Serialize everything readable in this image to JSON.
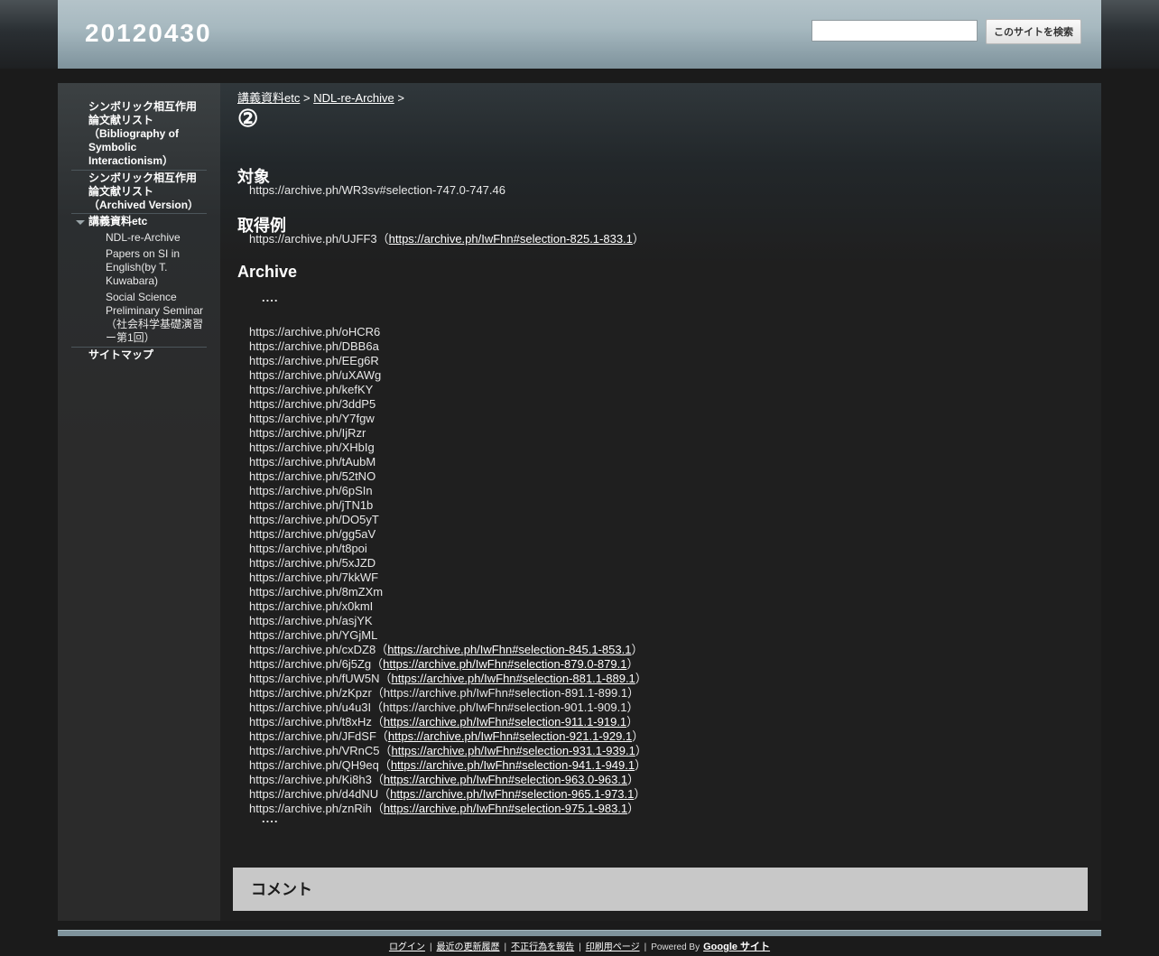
{
  "site": {
    "title": "20120430"
  },
  "search": {
    "placeholder": "",
    "button_label": "このサイトを検索"
  },
  "sidebar": {
    "items": [
      {
        "label": "シンボリック相互作用論文献リスト（Bibliography of Symbolic Interactionism）"
      },
      {
        "label": "シンボリック相互作用論文献リスト（Archived Version）"
      },
      {
        "label": "講義資料etc"
      },
      {
        "label": "NDL-re-Archive"
      },
      {
        "label": "Papers on SI in English(by T. Kuwabara)"
      },
      {
        "label": "Social Science Preliminary Seminar（社会科学基礎演習ー第1回）"
      },
      {
        "label": "サイトマップ"
      }
    ]
  },
  "breadcrumb": {
    "item1": "講義資料etc",
    "sep1": ">",
    "item2": "NDL-re-Archive",
    "sep2": ">"
  },
  "page": {
    "title": "②"
  },
  "sections": {
    "target_heading": "対象",
    "target_value": "https://archive.ph/WR3sv#selection-747.0-747.46",
    "example_heading": "取得例",
    "example_prefix": "https://archive.ph/UJFF3（",
    "example_link": "https://archive.ph/IwFhn#selection-825.1-833.1",
    "example_suffix": "）",
    "archive_heading": "Archive",
    "dots": "....",
    "dots_end": "...."
  },
  "archive_links": [
    {
      "short": "https://archive.ph/oHCR6"
    },
    {
      "short": "https://archive.ph/DBB6a"
    },
    {
      "short": "https://archive.ph/EEg6R"
    },
    {
      "short": "https://archive.ph/uXAWg"
    },
    {
      "short": "https://archive.ph/kefKY"
    },
    {
      "short": "https://archive.ph/3ddP5"
    },
    {
      "short": "https://archive.ph/Y7fgw"
    },
    {
      "short": "https://archive.ph/IjRzr"
    },
    {
      "short": "https://archive.ph/XHbIg"
    },
    {
      "short": "https://archive.ph/tAubM"
    },
    {
      "short": "https://archive.ph/52tNO"
    },
    {
      "short": "https://archive.ph/6pSIn"
    },
    {
      "short": "https://archive.ph/jTN1b"
    },
    {
      "short": "https://archive.ph/DO5yT"
    },
    {
      "short": "https://archive.ph/gg5aV"
    },
    {
      "short": "https://archive.ph/t8poi"
    },
    {
      "short": "https://archive.ph/5xJZD"
    },
    {
      "short": "https://archive.ph/7kkWF"
    },
    {
      "short": "https://archive.ph/8mZXm"
    },
    {
      "short": "https://archive.ph/x0kmI"
    },
    {
      "short": "https://archive.ph/asjYK"
    },
    {
      "short": "https://archive.ph/YGjML"
    },
    {
      "short": "https://archive.ph/cxDZ8",
      "selection": "https://archive.ph/IwFhn#selection-845.1-853.1",
      "linked": true
    },
    {
      "short": "https://archive.ph/6j5Zg",
      "selection": "https://archive.ph/IwFhn#selection-879.0-879.1",
      "linked": true
    },
    {
      "short": "https://archive.ph/fUW5N",
      "selection": "https://archive.ph/IwFhn#selection-881.1-889.1",
      "linked": true
    },
    {
      "short": "https://archive.ph/zKpzr",
      "selection": "https://archive.ph/IwFhn#selection-891.1-899.1",
      "linked": false
    },
    {
      "short": "https://archive.ph/u4u3I",
      "selection": "https://archive.ph/IwFhn#selection-901.1-909.1",
      "linked": false
    },
    {
      "short": "https://archive.ph/t8xHz",
      "selection": "https://archive.ph/IwFhn#selection-911.1-919.1",
      "linked": true
    },
    {
      "short": "https://archive.ph/JFdSF",
      "selection": "https://archive.ph/IwFhn#selection-921.1-929.1",
      "linked": true
    },
    {
      "short": "https://archive.ph/VRnC5",
      "selection": "https://archive.ph/IwFhn#selection-931.1-939.1",
      "linked": true
    },
    {
      "short": "https://archive.ph/QH9eq",
      "selection": "https://archive.ph/IwFhn#selection-941.1-949.1",
      "linked": true
    },
    {
      "short": "https://archive.ph/Ki8h3",
      "selection": "https://archive.ph/IwFhn#selection-963.0-963.1",
      "linked": true
    },
    {
      "short": "https://archive.ph/d4dNU",
      "selection": "https://archive.ph/IwFhn#selection-965.1-973.1",
      "linked": true
    },
    {
      "short": "https://archive.ph/znRih",
      "selection": "https://archive.ph/IwFhn#selection-975.1-983.1",
      "linked": true
    }
  ],
  "comments": {
    "title": "コメント"
  },
  "footer": {
    "login": "ログイン",
    "recent": "最近の更新履歴",
    "abuse": "不正行為を報告",
    "print": "印刷用ページ",
    "powered": "Powered By",
    "google_sites": "Google サイト",
    "sep": "|"
  }
}
